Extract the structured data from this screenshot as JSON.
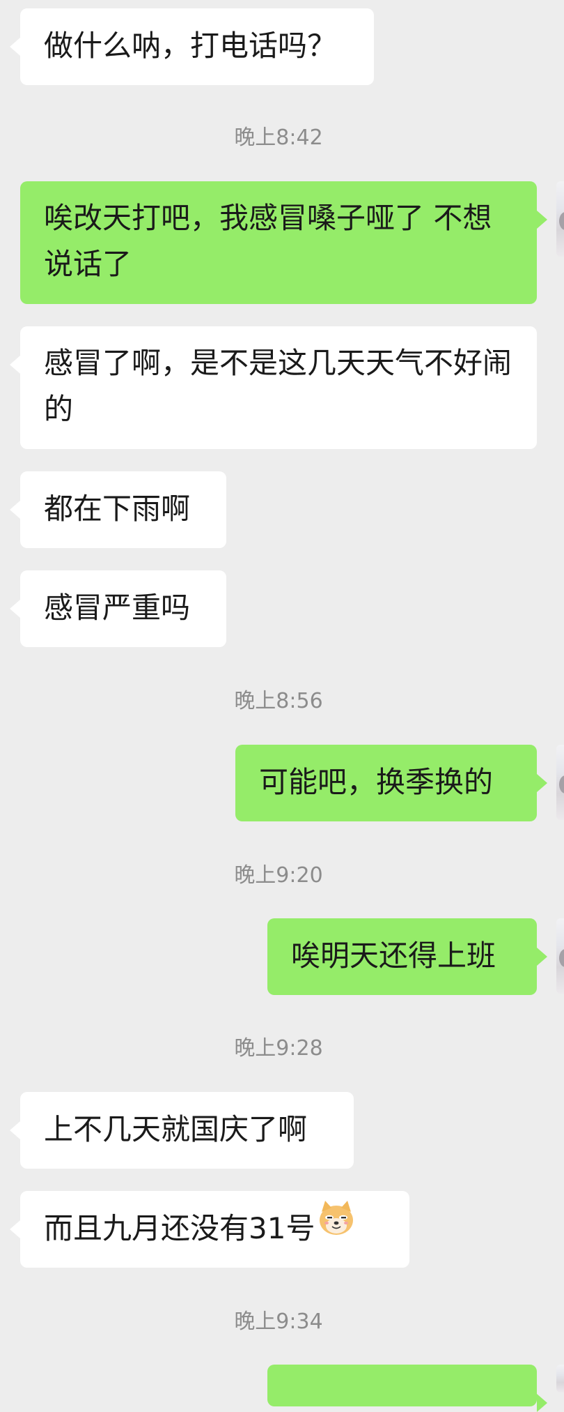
{
  "messages": [
    {
      "side": "in",
      "text": "做什么呐，打电话吗？"
    },
    {
      "time": "晚上8:42"
    },
    {
      "side": "out",
      "text": "唉改天打吧，我感冒嗓子哑了 不想说话了"
    },
    {
      "side": "in",
      "text": "感冒了啊，是不是这几天天气不好闹的"
    },
    {
      "side": "in",
      "text": "都在下雨啊"
    },
    {
      "side": "in",
      "text": "感冒严重吗"
    },
    {
      "time": "晚上8:56"
    },
    {
      "side": "out",
      "text": "可能吧，换季换的"
    },
    {
      "time": "晚上9:20"
    },
    {
      "side": "out",
      "text": "唉明天还得上班"
    },
    {
      "time": "晚上9:28"
    },
    {
      "side": "in",
      "text": "上不几天就国庆了啊"
    },
    {
      "side": "in",
      "text": "而且九月还没有31号",
      "emoji": "doge-emoji"
    },
    {
      "time": "晚上9:34"
    }
  ],
  "colors": {
    "background": "#ededed",
    "incoming_bubble": "#ffffff",
    "outgoing_bubble": "#95ec69",
    "timestamp_text": "#8c8c8c"
  },
  "icons": [
    "avatar",
    "doge-emoji"
  ]
}
